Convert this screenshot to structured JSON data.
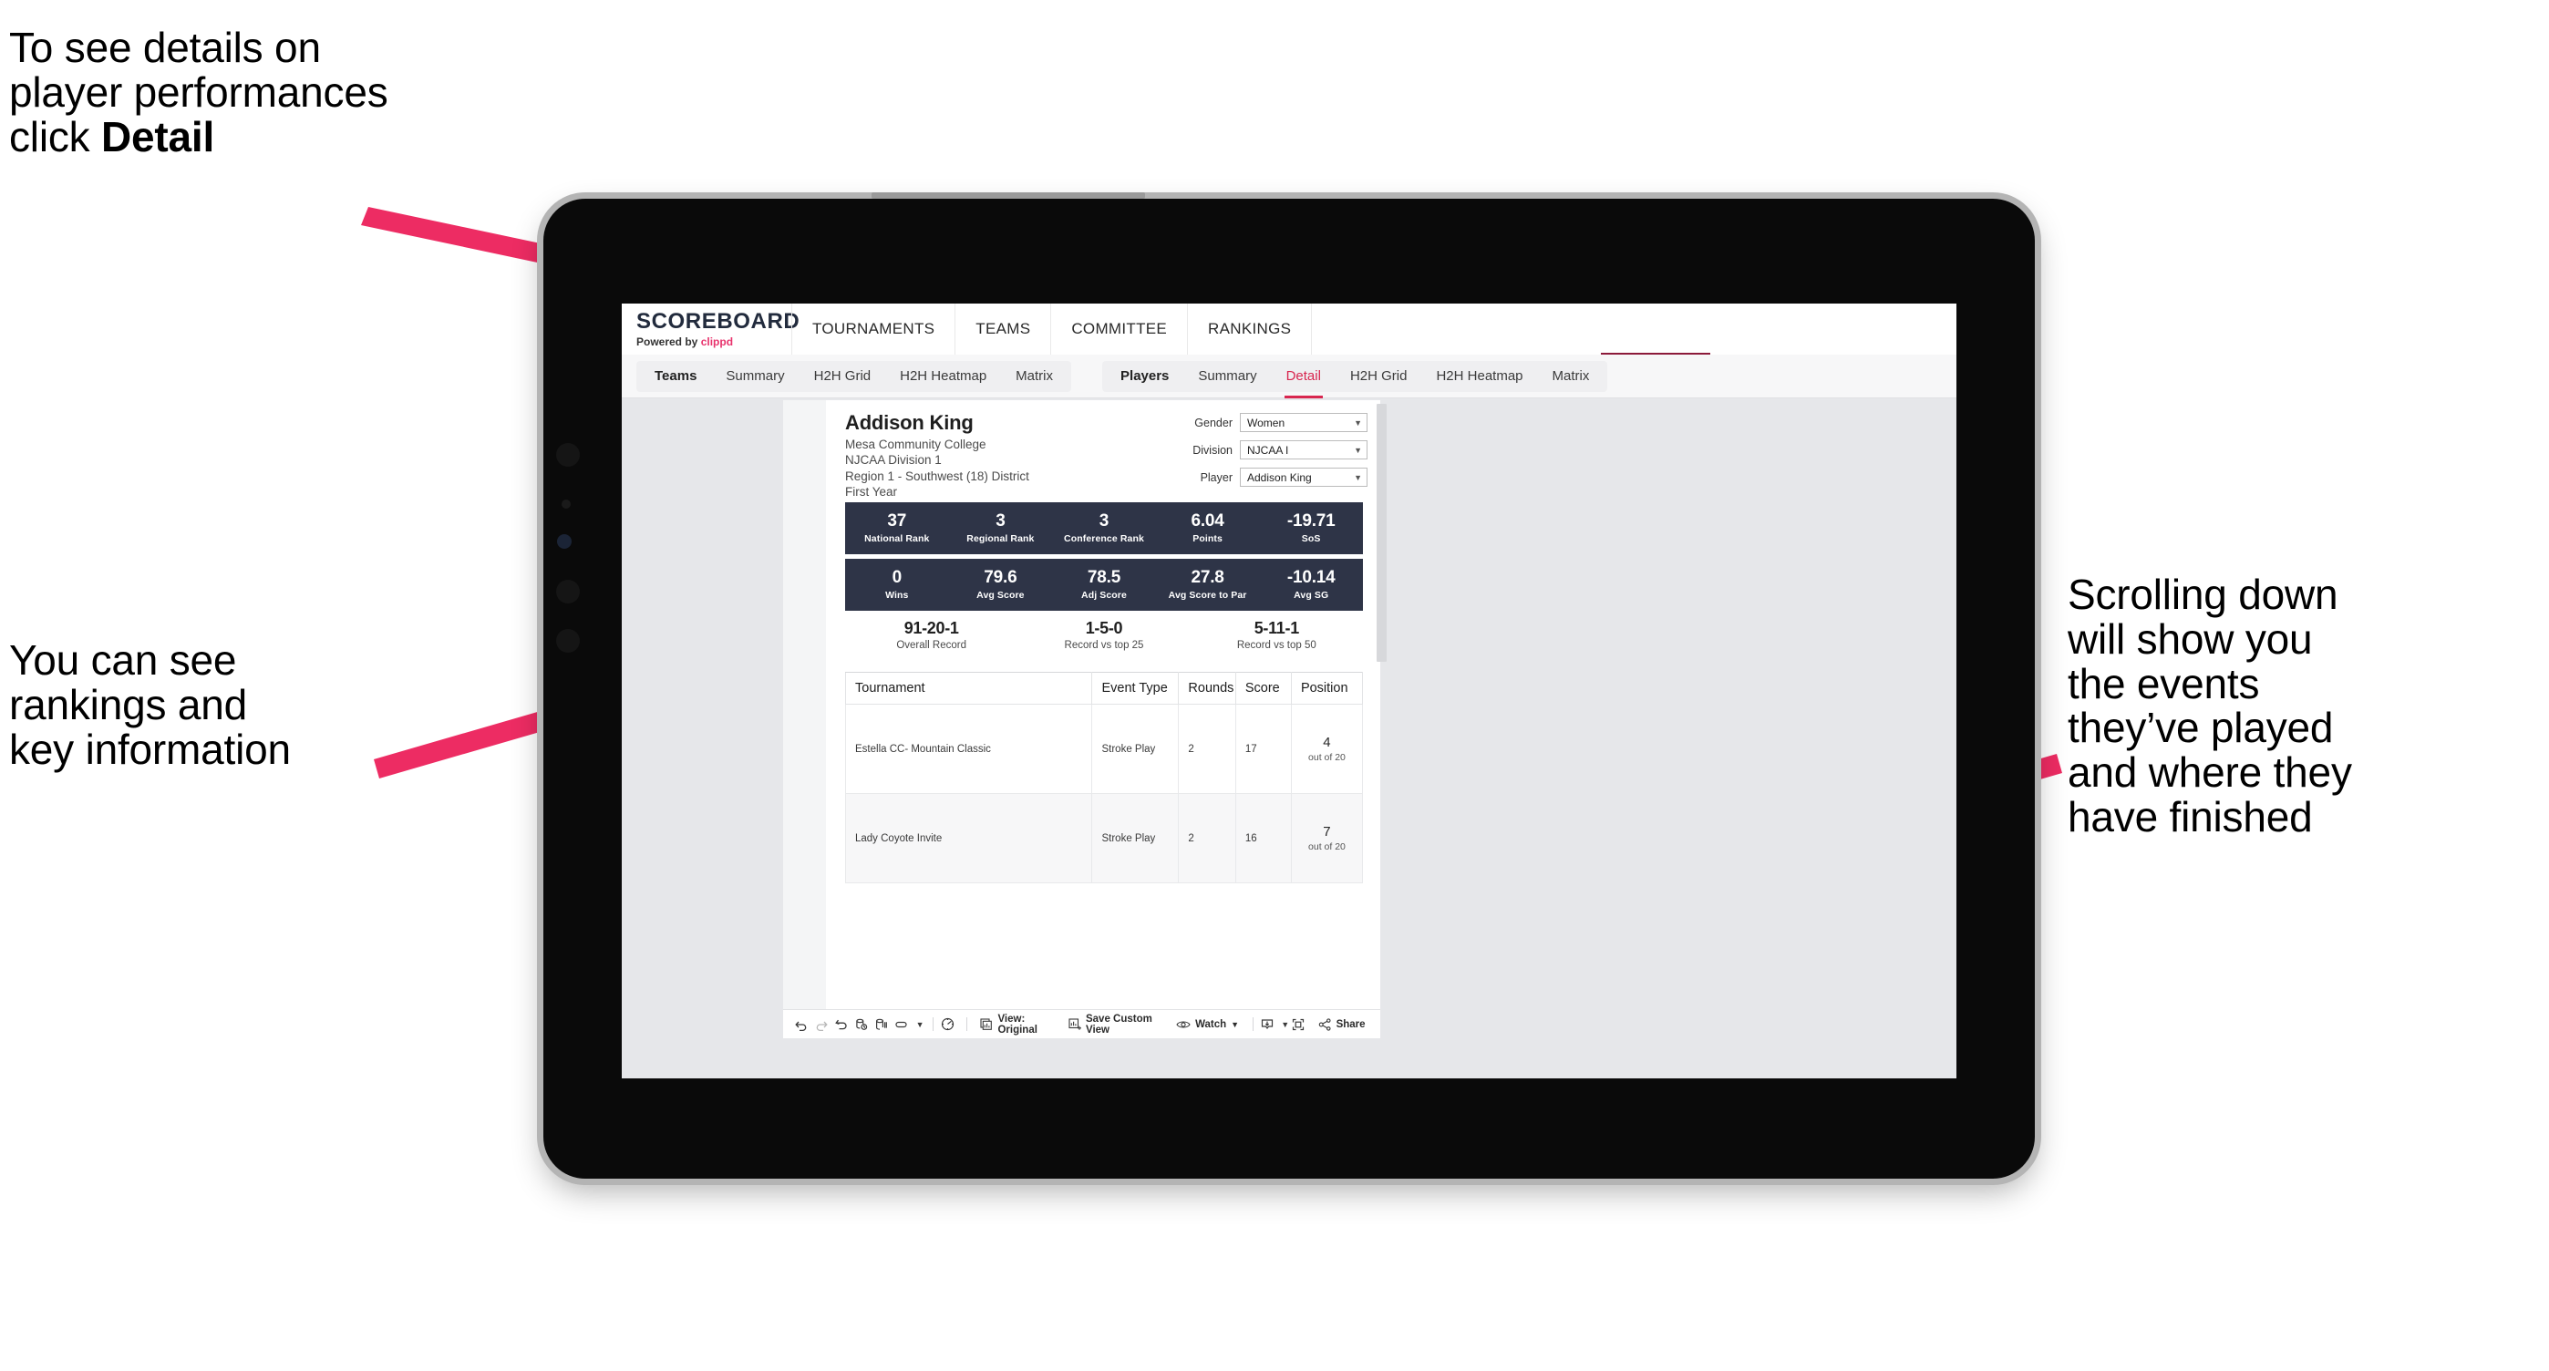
{
  "annotations": {
    "top_left": "To see details on\nplayer performances\nclick ",
    "top_left_bold": "Detail",
    "mid_left": "You can see\nrankings and\nkey information",
    "right": "Scrolling down\nwill show you\nthe events\nthey’ve played\nand where they\nhave finished"
  },
  "brand": {
    "title": "SCOREBOARD",
    "powered_prefix": "Powered by ",
    "powered_name": "clippd"
  },
  "main_nav": [
    {
      "label": "TOURNAMENTS"
    },
    {
      "label": "TEAMS"
    },
    {
      "label": "COMMITTEE"
    },
    {
      "label": "RANKINGS"
    }
  ],
  "tabs": {
    "teams_group": [
      {
        "label": "Teams",
        "lead": true,
        "active": false
      },
      {
        "label": "Summary",
        "lead": false,
        "active": false
      },
      {
        "label": "H2H Grid",
        "lead": false,
        "active": false
      },
      {
        "label": "H2H Heatmap",
        "lead": false,
        "active": false
      },
      {
        "label": "Matrix",
        "lead": false,
        "active": false
      }
    ],
    "players_group": [
      {
        "label": "Players",
        "lead": true,
        "active": false
      },
      {
        "label": "Summary",
        "lead": false,
        "active": false
      },
      {
        "label": "Detail",
        "lead": false,
        "active": true
      },
      {
        "label": "H2H Grid",
        "lead": false,
        "active": false
      },
      {
        "label": "H2H Heatmap",
        "lead": false,
        "active": false
      },
      {
        "label": "Matrix",
        "lead": false,
        "active": false
      }
    ]
  },
  "player": {
    "name": "Addison King",
    "school": "Mesa Community College",
    "division": "NJCAA Division 1",
    "region": "Region 1 - Southwest (18) District",
    "year": "First Year"
  },
  "filters": [
    {
      "label": "Gender",
      "value": "Women"
    },
    {
      "label": "Division",
      "value": "NJCAA I"
    },
    {
      "label": "Player",
      "value": "Addison King"
    }
  ],
  "stats_row1": [
    {
      "value": "37",
      "label": "National Rank"
    },
    {
      "value": "3",
      "label": "Regional Rank"
    },
    {
      "value": "3",
      "label": "Conference Rank"
    },
    {
      "value": "6.04",
      "label": "Points"
    },
    {
      "value": "-19.71",
      "label": "SoS"
    }
  ],
  "stats_row2": [
    {
      "value": "0",
      "label": "Wins"
    },
    {
      "value": "79.6",
      "label": "Avg Score"
    },
    {
      "value": "78.5",
      "label": "Adj Score"
    },
    {
      "value": "27.8",
      "label": "Avg Score to Par"
    },
    {
      "value": "-10.14",
      "label": "Avg SG"
    }
  ],
  "records": [
    {
      "value": "91-20-1",
      "label": "Overall Record"
    },
    {
      "value": "1-5-0",
      "label": "Record vs top 25"
    },
    {
      "value": "5-11-1",
      "label": "Record vs top 50"
    }
  ],
  "table": {
    "headers": [
      "Tournament",
      "Event Type",
      "Rounds",
      "Score",
      "Position"
    ],
    "rows": [
      {
        "tournament": "Estella CC- Mountain Classic",
        "event_type": "Stroke Play",
        "rounds": "2",
        "score": "17",
        "position_value": "4",
        "position_label": "out of 20"
      },
      {
        "tournament": "Lady Coyote Invite",
        "event_type": "Stroke Play",
        "rounds": "2",
        "score": "16",
        "position_value": "7",
        "position_label": "out of 20"
      }
    ]
  },
  "toolbar": {
    "view_label": "View: Original",
    "save_label": "Save Custom View",
    "watch_label": "Watch",
    "share_label": "Share"
  },
  "colors": {
    "accent_pink": "#e8336d",
    "active_tab": "#d8264f",
    "stat_navy": "#2e3447",
    "nav_underline": "#8c1a3a"
  }
}
